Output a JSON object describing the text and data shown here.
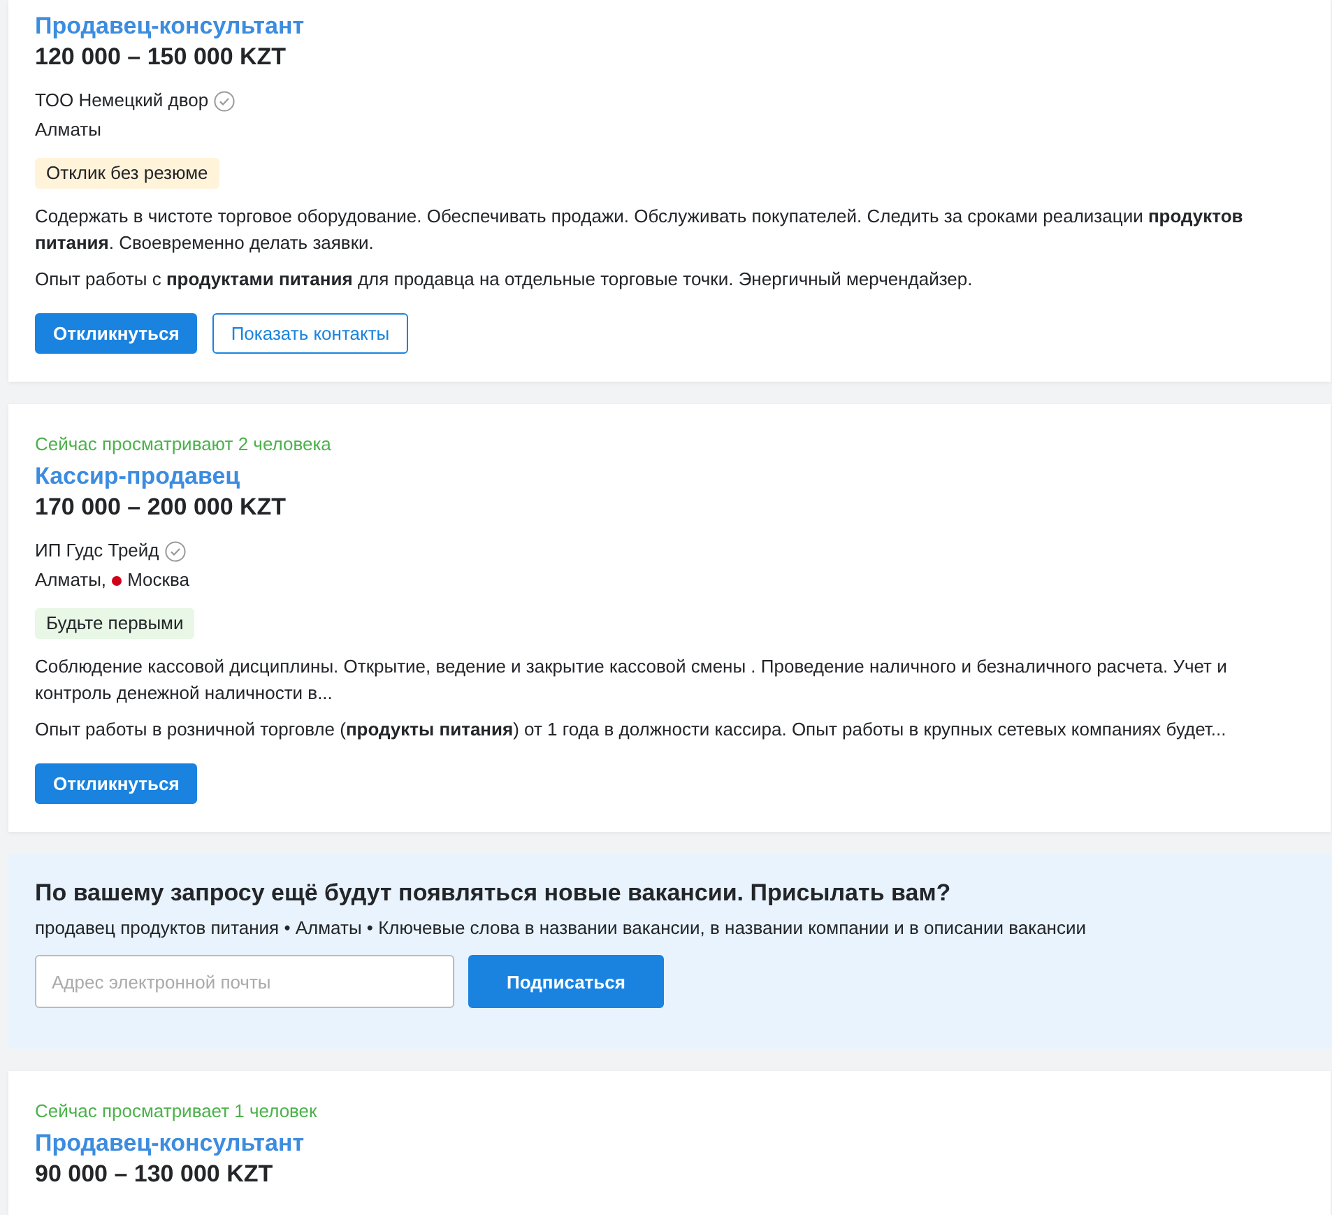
{
  "vacancies": [
    {
      "title": "Продавец-консультант",
      "salary": "120 000 – 150 000 KZT",
      "company": "ТОО Немецкий двор",
      "verified": true,
      "city": "Алматы",
      "badge": {
        "kind": "no-resume",
        "label": "Отклик без резюме"
      },
      "description": "Содержать в чистоте торговое оборудование. Обеспечивать продажи. Обслуживать покупателей. Следить за сроками реализации **продуктов питания**. Своевременно делать заявки.",
      "requirements": "Опыт работы с **продуктами питания** для продавца на отдельные торговые точки. Энергичный мерчендайзер.",
      "buttons": [
        {
          "kind": "primary",
          "label": "Откликнуться"
        },
        {
          "kind": "outline",
          "label": "Показать контакты"
        }
      ]
    },
    {
      "viewers": "Сейчас просматривают 2 человека",
      "title": "Кассир-продавец",
      "salary": "170 000 – 200 000 KZT",
      "company": "ИП Гудс Трейд",
      "verified": true,
      "city": "Алматы,",
      "metro": {
        "name": "Москва",
        "color": "#d0021b"
      },
      "badge": {
        "kind": "be-first",
        "label": "Будьте первыми"
      },
      "description": "Соблюдение кассовой дисциплины. Открытие, ведение и закрытие кассовой смены . Проведение наличного и безналичного расчета. Учет и контроль денежной наличности в...",
      "requirements": "Опыт работы в розничной торговле (**продукты питания**) от 1 года в должности кассира. Опыт работы в крупных сетевых компаниях будет...",
      "buttons": [
        {
          "kind": "primary",
          "label": "Откликнуться"
        }
      ]
    }
  ],
  "subscribe": {
    "title": "По вашему запросу ещё будут появляться новые вакансии. Присылать вам?",
    "query": "продавец продуктов питания • Алматы • Ключевые слова в названии вакансии, в названии компании и в описании вакансии",
    "email": {
      "placeholder": "Адрес электронной почты"
    },
    "button": "Подписаться"
  },
  "next_vacancy": {
    "viewers": "Сейчас просматривает 1 человек",
    "title": "Продавец-консультант",
    "salary": "90 000 – 130 000 KZT"
  }
}
